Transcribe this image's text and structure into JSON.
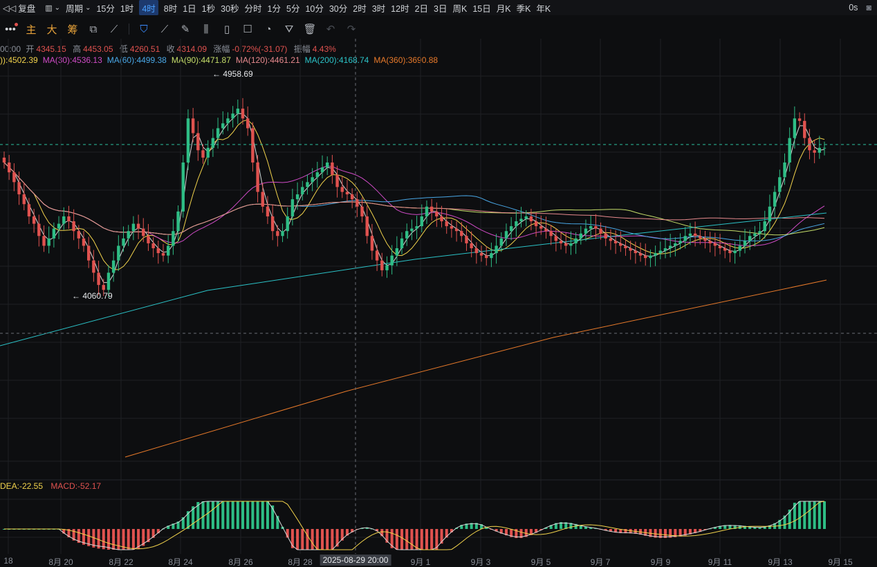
{
  "topbar": {
    "replay": "复盘",
    "period": "周期",
    "intervals": [
      "15分",
      "1时",
      "4时",
      "8时",
      "1日",
      "1秒",
      "30秒",
      "分时",
      "1分",
      "5分",
      "10分",
      "30分",
      "2时",
      "3时",
      "12时",
      "2日",
      "3日",
      "周K",
      "15日",
      "月K",
      "季K",
      "年K"
    ],
    "active_interval": "4时",
    "countdown": "0s"
  },
  "toolbar": {
    "main_label": "主",
    "big_label": "大",
    "chips_label": "筹"
  },
  "ohlc": {
    "time_fragment": "00:00",
    "open_label": "开",
    "open": "4345.15",
    "high_label": "高",
    "high": "4453.05",
    "low_label": "低",
    "low": "4260.51",
    "close_label": "收",
    "close": "4314.09",
    "change_label": "涨幅",
    "change": "-0.72%(-31.07)",
    "amp_label": "振幅",
    "amp": "4.43%"
  },
  "ma": [
    {
      "text": ")):4502.39",
      "color": "#f2d34c"
    },
    {
      "text": "MA(30):4536.13",
      "color": "#d04bc7"
    },
    {
      "text": "MA(60):4499.38",
      "color": "#49a7e6"
    },
    {
      "text": "MA(90):4471.87",
      "color": "#c6df6a"
    },
    {
      "text": "MA(120):4461.21",
      "color": "#e88a8e"
    },
    {
      "text": "MA(200):4168.74",
      "color": "#2bc3c8"
    },
    {
      "text": "MA(360):3690.88",
      "color": "#e87a2a"
    }
  ],
  "annotations": {
    "high_marker": "4958.69",
    "low_marker": "4060.79"
  },
  "macd": {
    "dea": "DEA:-22.55",
    "macd": "MACD:-52.17"
  },
  "xaxis": {
    "labels": [
      "18",
      "8月 20",
      "8月 22",
      "8月 24",
      "8月 26",
      "8月 28",
      "9月 1",
      "9月 3",
      "9月 5",
      "9月 7",
      "9月 9",
      "9月 11",
      "9月 13",
      "9月 15"
    ],
    "crosshair_time": "2025-08-29 20:00"
  },
  "colors": {
    "up": "#2ebd85",
    "down": "#e0524f",
    "accent": "#3b8cff"
  }
}
